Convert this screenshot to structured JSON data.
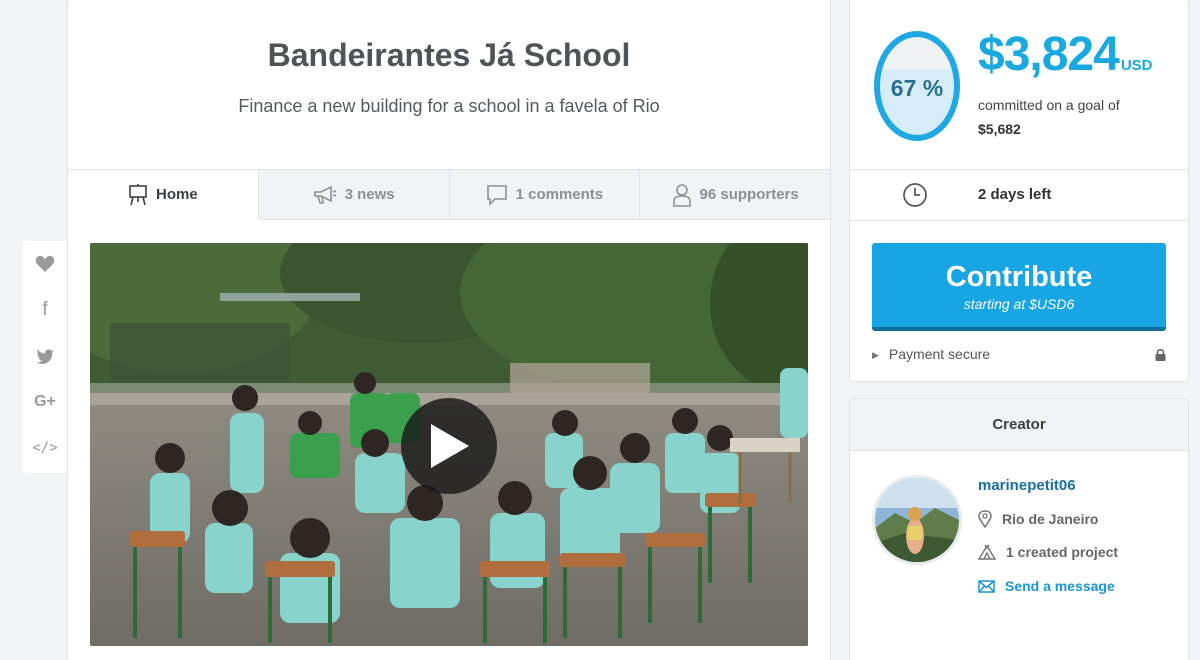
{
  "project": {
    "title": "Bandeirantes Já School",
    "subtitle": "Finance a new building for a school in a favela of Rio"
  },
  "social": [
    {
      "icon": "heart-icon"
    },
    {
      "icon": "facebook-icon",
      "glyph": "f"
    },
    {
      "icon": "twitter-icon"
    },
    {
      "icon": "google-plus-icon",
      "glyph": "G+"
    },
    {
      "icon": "embed-icon",
      "glyph": "</>"
    }
  ],
  "tabs": [
    {
      "label": "Home",
      "icon": "easel-icon",
      "active": true
    },
    {
      "label": "3 news",
      "icon": "megaphone-icon",
      "active": false
    },
    {
      "label": "1 comments",
      "icon": "comment-icon",
      "active": false
    },
    {
      "label": "96 supporters",
      "icon": "user-icon",
      "active": false
    }
  ],
  "funding": {
    "percent_label": "67 %",
    "percent_value": 67,
    "amount": "$3,824",
    "currency": "USD",
    "committed_text": "committed on a goal of",
    "goal": "$5,682",
    "days_left": "2 days left"
  },
  "contribute": {
    "label": "Contribute",
    "sub": "starting at $USD6"
  },
  "payment_secure": "Payment secure",
  "creator": {
    "heading": "Creator",
    "name": "marinepetit06",
    "location": "Rio de Janeiro",
    "projects": "1 created project",
    "message": "Send a message"
  },
  "colors": {
    "accent": "#17a5e3",
    "accent_dark": "#0d6c98",
    "link": "#1b6f9d",
    "gauge_fill": "#d6ecf8"
  }
}
